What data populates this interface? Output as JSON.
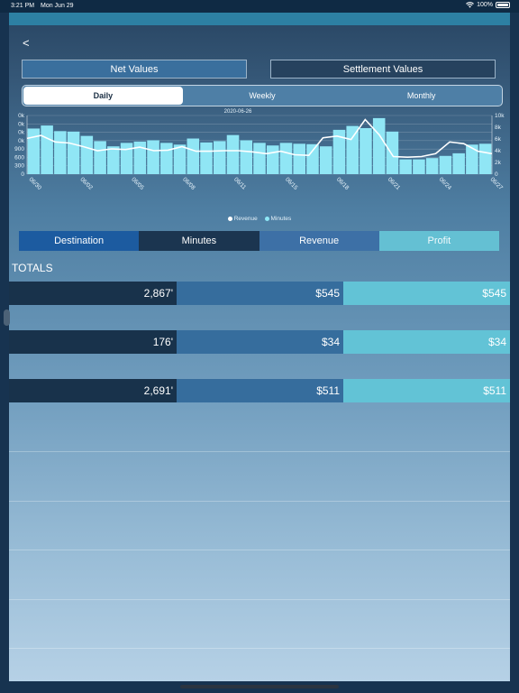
{
  "status": {
    "time": "3:21 PM",
    "date": "Mon Jun 29",
    "battery": "100%",
    "wifi_icon": "wifi-icon"
  },
  "nav": {
    "back_label": "<"
  },
  "value_toggle": {
    "net": "Net Values",
    "settlement": "Settlement Values"
  },
  "period": {
    "daily": "Daily",
    "weekly": "Weekly",
    "monthly": "Monthly"
  },
  "chart_data": {
    "type": "bar+line",
    "selected_date": "2020-06-26",
    "left_ticks": [
      "0",
      "300",
      "600",
      "900",
      "0k",
      "0k",
      "0k",
      "0k"
    ],
    "right_ticks": [
      "0",
      "2k",
      "4k",
      "6k",
      "8k",
      "10k"
    ],
    "x_labels": [
      "06/30",
      "06/02",
      "06/05",
      "06/08",
      "06/11",
      "06/15",
      "06/18",
      "06/21",
      "06/24",
      "06/27"
    ],
    "minutes": [
      1050,
      1120,
      990,
      980,
      880,
      760,
      640,
      720,
      750,
      780,
      720,
      680,
      820,
      730,
      760,
      900,
      780,
      720,
      660,
      720,
      700,
      690,
      640,
      1020,
      1110,
      1060,
      1290,
      980,
      340,
      340,
      370,
      420,
      480,
      680,
      700
    ],
    "revenue": [
      6100,
      6600,
      5500,
      5300,
      4700,
      4000,
      4300,
      4200,
      4600,
      4000,
      4100,
      4700,
      3900,
      3900,
      4000,
      4000,
      3800,
      3500,
      3900,
      3300,
      3200,
      6200,
      6500,
      5900,
      9300,
      6700,
      3000,
      2900,
      3000,
      3500,
      5500,
      5200,
      3900,
      3500
    ],
    "legend": [
      {
        "name": "Revenue",
        "color": "#ffffff"
      },
      {
        "name": "Minutes",
        "color": "#8ee8f6"
      }
    ],
    "colors": {
      "bar": "#90e6f5",
      "line": "#ffffff"
    }
  },
  "tabs": {
    "destination": "Destination",
    "minutes": "Minutes",
    "revenue": "Revenue",
    "profit": "Profit"
  },
  "totals_label": "TOTALS",
  "rows": [
    {
      "minutes": "2,867'",
      "revenue": "$545",
      "profit": "$545"
    },
    {
      "minutes": "176'",
      "revenue": "$34",
      "profit": "$34"
    },
    {
      "minutes": "2,691'",
      "revenue": "$511",
      "profit": "$511"
    }
  ],
  "colors": {
    "accent": "#2d80a3",
    "destination": "#1c5ba0",
    "minutes": "#1b3550",
    "revenue": "#3d70a6",
    "profit": "#64c0d3"
  }
}
